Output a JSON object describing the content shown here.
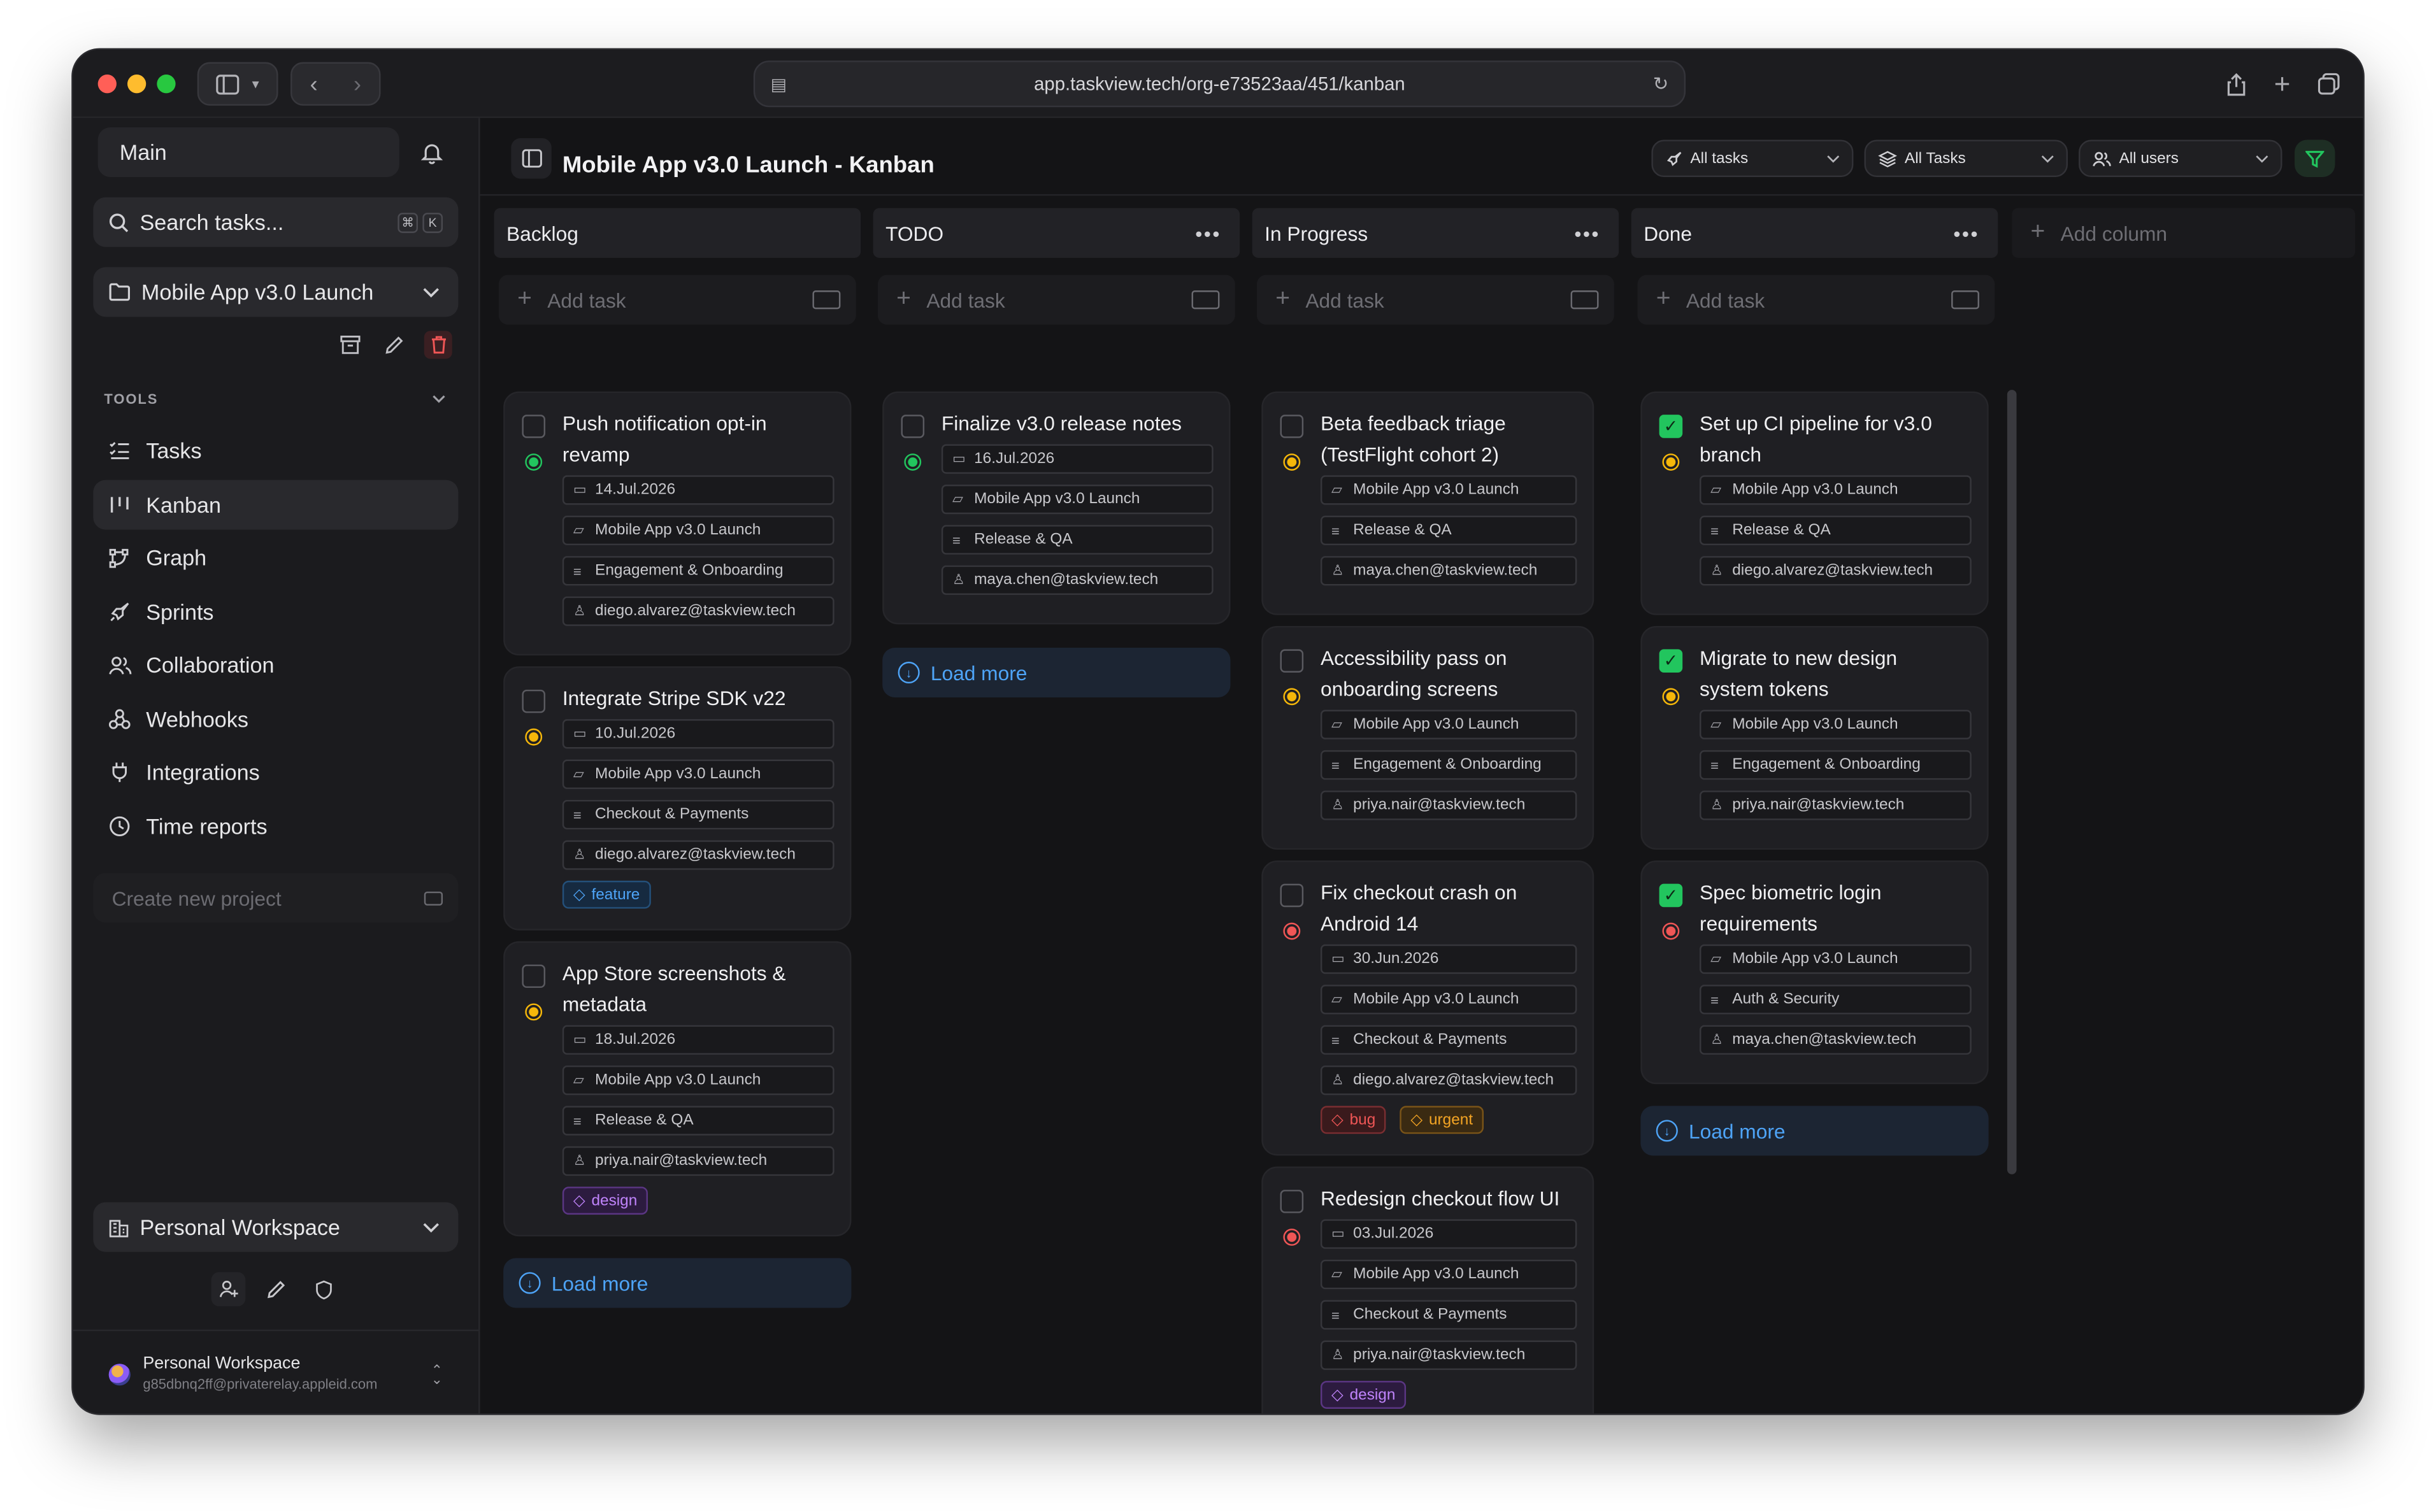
{
  "browser": {
    "url": "app.taskview.tech/org-e73523aa/451/kanban"
  },
  "sidebar": {
    "workspace_selector": "Main",
    "search_placeholder": "Search tasks...",
    "search_kbd": [
      "⌘",
      "K"
    ],
    "project_selector": "Mobile App v3.0 Launch",
    "tools_label": "TOOLS",
    "nav": [
      {
        "label": "Tasks",
        "icon": "tasks-icon"
      },
      {
        "label": "Kanban",
        "icon": "kanban-icon"
      },
      {
        "label": "Graph",
        "icon": "graph-icon"
      },
      {
        "label": "Sprints",
        "icon": "rocket-icon"
      },
      {
        "label": "Collaboration",
        "icon": "users-icon"
      },
      {
        "label": "Webhooks",
        "icon": "webhook-icon"
      },
      {
        "label": "Integrations",
        "icon": "plug-icon"
      },
      {
        "label": "Time reports",
        "icon": "clock-icon"
      }
    ],
    "create_project_placeholder": "Create new project",
    "org_selector": "Personal Workspace",
    "account": {
      "name": "Personal Workspace",
      "email": "g85dbnq2ff@privaterelay.appleid.com"
    }
  },
  "header": {
    "title": "Mobile App v3.0 Launch - Kanban",
    "filters": [
      "All tasks",
      "All Tasks",
      "All users"
    ]
  },
  "board": {
    "add_task_label": "Add task",
    "add_column_label": "Add column",
    "load_more_label": "Load more",
    "columns": [
      {
        "name": "Backlog",
        "cards": [
          {
            "title_lines": [
              "Push notification opt-in",
              "revamp"
            ],
            "priority": "green",
            "date": "14.Jul.2026",
            "project": "Mobile App v3.0 Launch",
            "list": "Engagement & Onboarding",
            "assignee": "diego.alvarez@taskview.tech",
            "tags": []
          },
          {
            "title_lines": [
              "Integrate Stripe SDK v22"
            ],
            "priority": "yellow",
            "date": "10.Jul.2026",
            "project": "Mobile App v3.0 Launch",
            "list": "Checkout & Payments",
            "assignee": "diego.alvarez@taskview.tech",
            "tags": [
              "feature"
            ]
          },
          {
            "title_lines": [
              "App Store screenshots &",
              "metadata"
            ],
            "priority": "yellow",
            "date": "18.Jul.2026",
            "project": "Mobile App v3.0 Launch",
            "list": "Release & QA",
            "assignee": "priya.nair@taskview.tech",
            "tags": [
              "design"
            ]
          }
        ]
      },
      {
        "name": "TODO",
        "cards": [
          {
            "title_lines": [
              "Finalize v3.0 release notes"
            ],
            "priority": "green",
            "date": "16.Jul.2026",
            "project": "Mobile App v3.0 Launch",
            "list": "Release & QA",
            "assignee": "maya.chen@taskview.tech",
            "tags": []
          }
        ]
      },
      {
        "name": "In Progress",
        "cards": [
          {
            "title_lines": [
              "Beta feedback triage",
              "(TestFlight cohort 2)"
            ],
            "priority": "yellow",
            "project": "Mobile App v3.0 Launch",
            "list": "Release & QA",
            "assignee": "maya.chen@taskview.tech",
            "tags": []
          },
          {
            "title_lines": [
              "Accessibility pass on",
              "onboarding screens"
            ],
            "priority": "yellow",
            "project": "Mobile App v3.0 Launch",
            "list": "Engagement & Onboarding",
            "assignee": "priya.nair@taskview.tech",
            "tags": []
          },
          {
            "title_lines": [
              "Fix checkout crash on",
              "Android 14"
            ],
            "priority": "red",
            "date": "30.Jun.2026",
            "project": "Mobile App v3.0 Launch",
            "list": "Checkout & Payments",
            "assignee": "diego.alvarez@taskview.tech",
            "tags": [
              "bug",
              "urgent"
            ]
          },
          {
            "title_lines": [
              "Redesign checkout flow UI"
            ],
            "priority": "red",
            "date": "03.Jul.2026",
            "project": "Mobile App v3.0 Launch",
            "list": "Checkout & Payments",
            "assignee": "priya.nair@taskview.tech",
            "tags": [
              "design"
            ]
          }
        ]
      },
      {
        "name": "Done",
        "cards": [
          {
            "title_lines": [
              "Set up CI pipeline for v3.0",
              "branch"
            ],
            "priority": "yellow",
            "done": true,
            "project": "Mobile App v3.0 Launch",
            "list": "Release & QA",
            "assignee": "diego.alvarez@taskview.tech",
            "tags": []
          },
          {
            "title_lines": [
              "Migrate to new design",
              "system tokens"
            ],
            "priority": "yellow",
            "done": true,
            "project": "Mobile App v3.0 Launch",
            "list": "Engagement & Onboarding",
            "assignee": "priya.nair@taskview.tech",
            "tags": []
          },
          {
            "title_lines": [
              "Spec biometric login",
              "requirements"
            ],
            "priority": "red",
            "done": true,
            "project": "Mobile App v3.0 Launch",
            "list": "Auth & Security",
            "assignee": "maya.chen@taskview.tech",
            "tags": []
          }
        ]
      }
    ]
  },
  "colors": {
    "priority_green": "#22c55e",
    "priority_yellow": "#f5b70a",
    "priority_red": "#f05656",
    "link_blue": "#4ea4f7",
    "tag_feature": "#4ea4f7",
    "tag_design": "#c084fc",
    "tag_bug": "#f05656",
    "tag_urgent": "#f5a524"
  }
}
